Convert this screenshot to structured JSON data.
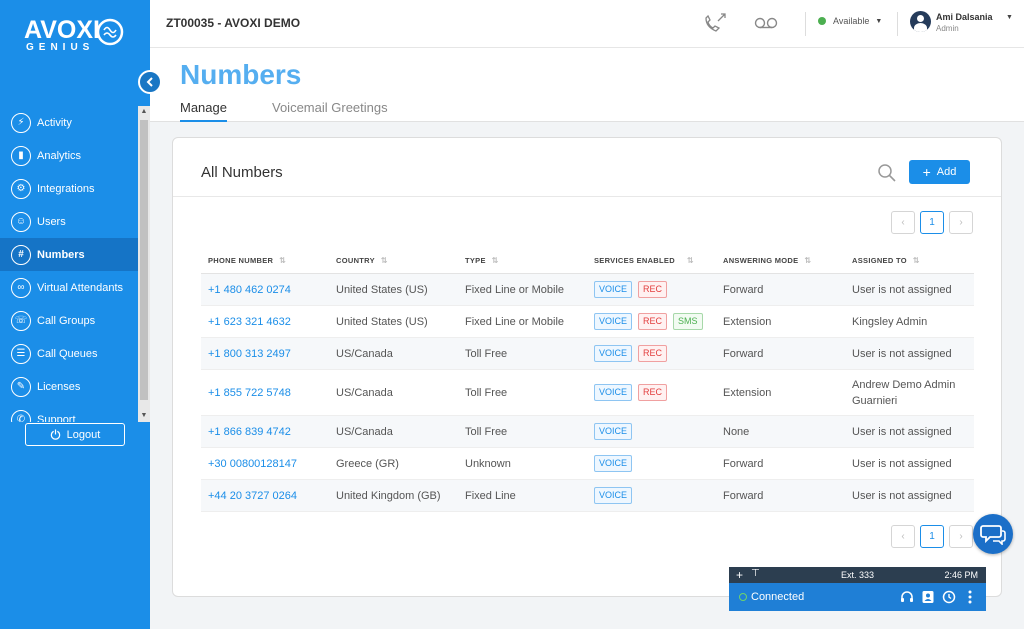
{
  "brand": {
    "name": "AVOXI",
    "sub": "GENIUS"
  },
  "colors": {
    "sidebar": "#1b8ee8",
    "accent": "#1b8ee8",
    "title": "#55aef0",
    "voice": "#1b8ee8",
    "rec": "#e23d3d",
    "sms": "#4caf50"
  },
  "sidebar": {
    "items": [
      {
        "label": "Activity",
        "icon": "lightning-icon"
      },
      {
        "label": "Analytics",
        "icon": "bar-chart-icon"
      },
      {
        "label": "Integrations",
        "icon": "gears-icon"
      },
      {
        "label": "Users",
        "icon": "users-icon"
      },
      {
        "label": "Numbers",
        "icon": "hash-icon",
        "active": true
      },
      {
        "label": "Virtual Attendants",
        "icon": "voicemail-icon"
      },
      {
        "label": "Call Groups",
        "icon": "call-group-icon"
      },
      {
        "label": "Call Queues",
        "icon": "queue-icon"
      },
      {
        "label": "Licenses",
        "icon": "license-icon"
      },
      {
        "label": "Support",
        "icon": "support-icon"
      }
    ],
    "logout_label": "Logout"
  },
  "topbar": {
    "account_title": "ZT00035 - AVOXI DEMO",
    "status_label": "Available",
    "user_name": "Ami Dalsania",
    "user_role": "Admin"
  },
  "page": {
    "title": "Numbers",
    "tabs": [
      {
        "label": "Manage",
        "active": true
      },
      {
        "label": "Voicemail Greetings",
        "active": false
      }
    ]
  },
  "card": {
    "title": "All Numbers",
    "add_label": "Add",
    "current_page": "1"
  },
  "table": {
    "headers": [
      "PHONE NUMBER",
      "COUNTRY",
      "TYPE",
      "SERVICES ENABLED",
      "ANSWERING MODE",
      "ASSIGNED TO"
    ],
    "rows": [
      {
        "phone": "+1 480 462 0274",
        "country": "United States (US)",
        "type": "Fixed Line or Mobile",
        "services": [
          "VOICE",
          "REC"
        ],
        "mode": "Forward",
        "assigned": "User is not assigned"
      },
      {
        "phone": "+1 623 321 4632",
        "country": "United States (US)",
        "type": "Fixed Line or Mobile",
        "services": [
          "VOICE",
          "REC",
          "SMS"
        ],
        "mode": "Extension",
        "assigned": "Kingsley Admin"
      },
      {
        "phone": "+1 800 313 2497",
        "country": "US/Canada",
        "type": "Toll Free",
        "services": [
          "VOICE",
          "REC"
        ],
        "mode": "Forward",
        "assigned": "User is not assigned"
      },
      {
        "phone": "+1 855 722 5748",
        "country": "US/Canada",
        "type": "Toll Free",
        "services": [
          "VOICE",
          "REC"
        ],
        "mode": "Extension",
        "assigned": "Andrew Demo Admin Guarnieri"
      },
      {
        "phone": "+1 866 839 4742",
        "country": "US/Canada",
        "type": "Toll Free",
        "services": [
          "VOICE"
        ],
        "mode": "None",
        "assigned": "User is not assigned"
      },
      {
        "phone": "+30 00800128147",
        "country": "Greece (GR)",
        "type": "Unknown",
        "services": [
          "VOICE"
        ],
        "mode": "Forward",
        "assigned": "User is not assigned"
      },
      {
        "phone": "+44 20 3727 0264",
        "country": "United Kingdom (GB)",
        "type": "Fixed Line",
        "services": [
          "VOICE"
        ],
        "mode": "Forward",
        "assigned": "User is not assigned"
      }
    ]
  },
  "phone_widget": {
    "ext": "Ext. 333",
    "time": "2:46 PM",
    "status": "Connected"
  }
}
